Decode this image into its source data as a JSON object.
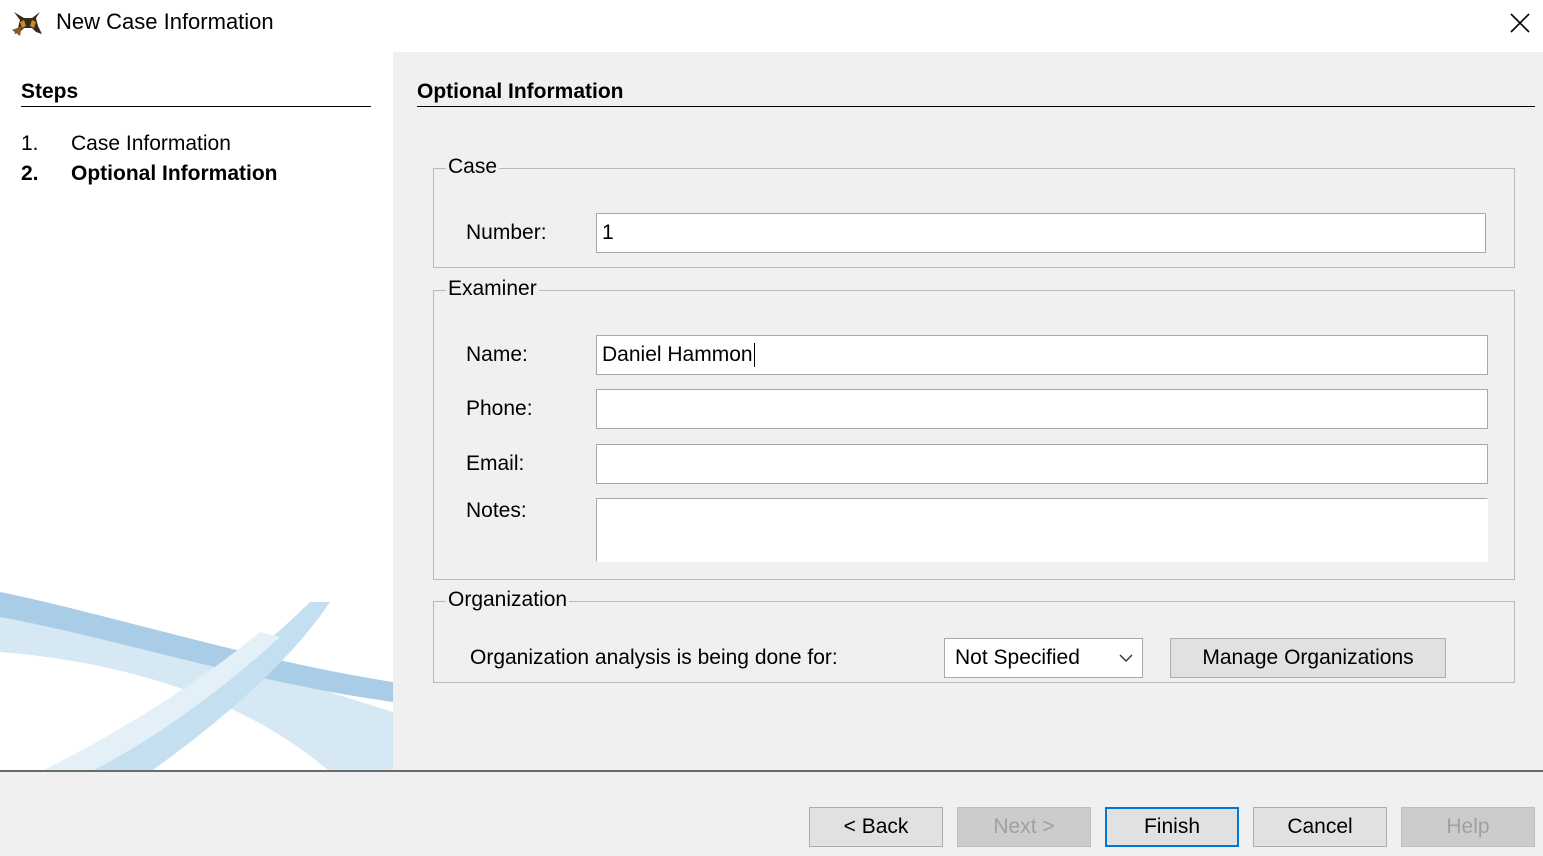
{
  "window": {
    "title": "New Case Information",
    "icon": "autopsy-dog-icon",
    "close_icon": "close-icon"
  },
  "steps": {
    "heading": "Steps",
    "items": [
      {
        "number": "1.",
        "label": "Case Information",
        "current": false
      },
      {
        "number": "2.",
        "label": "Optional Information",
        "current": true
      }
    ]
  },
  "content": {
    "heading": "Optional Information",
    "case_group": {
      "legend": "Case",
      "number_label": "Number:",
      "number_value": "1"
    },
    "examiner_group": {
      "legend": "Examiner",
      "name_label": "Name:",
      "name_value": "Daniel Hammon",
      "phone_label": "Phone:",
      "phone_value": "",
      "email_label": "Email:",
      "email_value": "",
      "notes_label": "Notes:",
      "notes_value": ""
    },
    "organization_group": {
      "legend": "Organization",
      "analysis_label": "Organization analysis is being done for:",
      "selected_org": "Not Specified",
      "manage_button": "Manage Organizations"
    }
  },
  "buttons": {
    "back": "< Back",
    "next": "Next >",
    "finish": "Finish",
    "cancel": "Cancel",
    "help": "Help"
  },
  "colors": {
    "panel_bg": "#f0f0f0",
    "focus_border": "#0078d7",
    "swoosh": "#7fb5d8"
  }
}
